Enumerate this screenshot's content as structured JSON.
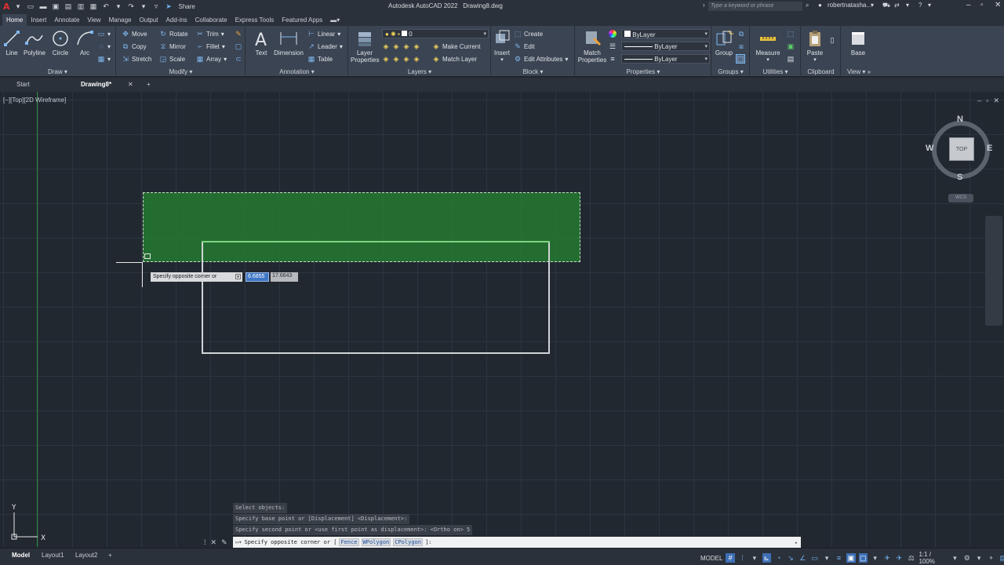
{
  "titlebar": {
    "app_title": "Autodesk AutoCAD 2022",
    "file_name": "Drawing8.dwg",
    "share_label": "Share",
    "search_placeholder": "Type a keyword or phrase",
    "user_name": "robertnatasha..."
  },
  "ribbon_tabs": [
    "Home",
    "Insert",
    "Annotate",
    "View",
    "Manage",
    "Output",
    "Add-ins",
    "Collaborate",
    "Express Tools",
    "Featured Apps"
  ],
  "ribbon": {
    "draw": {
      "title": "Draw",
      "line": "Line",
      "polyline": "Polyline",
      "circle": "Circle",
      "arc": "Arc"
    },
    "modify": {
      "title": "Modify",
      "move": "Move",
      "rotate": "Rotate",
      "trim": "Trim",
      "copy": "Copy",
      "mirror": "Mirror",
      "fillet": "Fillet",
      "stretch": "Stretch",
      "scale": "Scale",
      "array": "Array"
    },
    "annotation": {
      "title": "Annotation",
      "text": "Text",
      "dimension": "Dimension",
      "linear": "Linear",
      "leader": "Leader",
      "table": "Table"
    },
    "layers": {
      "title": "Layers",
      "layer_properties": "Layer Properties",
      "current_layer": "0",
      "make_current": "Make Current",
      "match_layer": "Match Layer"
    },
    "block": {
      "title": "Block",
      "insert": "Insert",
      "create": "Create",
      "edit": "Edit",
      "edit_attributes": "Edit Attributes"
    },
    "properties": {
      "title": "Properties",
      "match_properties": "Match Properties",
      "color": "ByLayer",
      "linetype": "ByLayer",
      "lineweight": "ByLayer"
    },
    "groups": {
      "title": "Groups",
      "group": "Group"
    },
    "utilities": {
      "title": "Utilities",
      "measure": "Measure"
    },
    "clipboard": {
      "title": "Clipboard",
      "paste": "Paste"
    },
    "view": {
      "title": "View",
      "base": "Base"
    }
  },
  "file_tabs": {
    "start": "Start",
    "drawing": "Drawing8*"
  },
  "viewport": {
    "label": "[−][Top][2D Wireframe]",
    "viewcube": {
      "top": "TOP",
      "north": "N",
      "south": "S",
      "east": "E",
      "west": "W"
    },
    "wcs": "WCS"
  },
  "dynamic_input": {
    "prompt": "Specify opposite corner or",
    "x_value": "6.6855",
    "y_value": "17.6643"
  },
  "command": {
    "history": [
      "Select objects:",
      "Specify base point or [Displacement] <Displacement>:",
      "Specify second point or <use first point as displacement>: <Ortho on> 5"
    ],
    "prompt_prefix": "Specify opposite corner or [",
    "options": [
      "Fence",
      "WPolygon",
      "CPolygon"
    ],
    "prompt_suffix": "]:"
  },
  "ucs": {
    "x": "X",
    "y": "Y"
  },
  "status": {
    "layout_tabs": [
      "Model",
      "Layout1",
      "Layout2"
    ],
    "model_label": "MODEL",
    "scale": "1:1 / 100%"
  }
}
